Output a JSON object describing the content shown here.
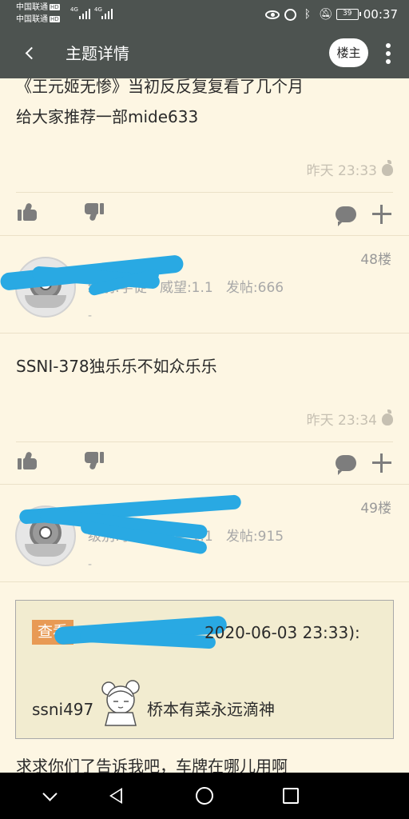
{
  "status_bar": {
    "carrier1": "中国联通",
    "carrier2": "中国联通",
    "hd": "HD",
    "net1": "4G",
    "net2": "4G",
    "battery": "39",
    "time": "00:37"
  },
  "title_bar": {
    "title": "主题详情",
    "owner_button": "楼主"
  },
  "posts": [
    {
      "lines": [
        "《王元姬无惨》当初反反复复看了几个月",
        "给大家推荐一部mide633"
      ],
      "time": "昨天 23:33"
    },
    {
      "floor": "48楼",
      "user_info": "级别:学徒   威望:1.1   发帖:666",
      "signature": "-",
      "lines": [
        "SSNI-378独乐乐不如众乐乐"
      ],
      "time": "昨天 23:34"
    },
    {
      "floor": "49楼",
      "user_info": "级别:学徒   威望:1.1   发帖:915",
      "signature": "-",
      "quote": {
        "tag": "查看",
        "time": "2020-06-03 23:33):",
        "text_before": "ssni497",
        "text_after": "桥本有菜永远滴神"
      },
      "lines": [
        "求求你们了告诉我吧，车牌在哪儿用啊"
      ]
    }
  ],
  "colors": {
    "bar": "#4d5350",
    "background": "#fdf6e3",
    "redaction": "#29a9e3",
    "quote_tag": "#e89a55"
  }
}
